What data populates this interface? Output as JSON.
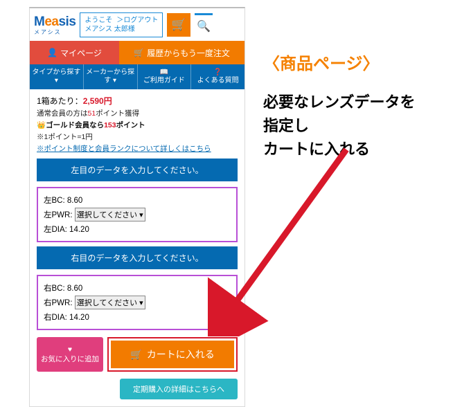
{
  "header": {
    "logo_sub": "メアシス",
    "welcome_l1": "ようこそ",
    "welcome_l2": "メアシス 太郎様",
    "logout": "＞ログアウト"
  },
  "buttons": {
    "mypage": "マイページ",
    "reorder": "履歴からもう一度注文"
  },
  "nav": {
    "type": "タイプから探す ▾",
    "maker": "メーカーから探す ▾",
    "guide": "ご利用ガイド",
    "faq": "よくある質問"
  },
  "product": {
    "price_label": "1箱あたり：",
    "price": "2,590円",
    "points_pre": "通常会員の方は",
    "points_num": "51",
    "points_post": "ポイント獲得",
    "gold_pre": "ゴールド会員なら",
    "gold_num": "153",
    "gold_post": "ポイント",
    "point_note": "※1ポイント=1円",
    "point_link": "※ポイント制度と会員ランクについて詳しくはこちら"
  },
  "left": {
    "header": "左目のデータを入力してください。",
    "bc": "左BC: 8.60",
    "pwr_label": "左PWR:",
    "pwr_select": "選択してください ▾",
    "dia": "左DIA: 14.20"
  },
  "right": {
    "header": "右目のデータを入力してください。",
    "bc": "右BC: 8.60",
    "pwr_label": "右PWR:",
    "pwr_select": "選択してください ▾",
    "dia": "右DIA: 14.20"
  },
  "actions": {
    "fav": "お気に入りに追加",
    "cart": "カートに入れる",
    "teiki": "定期購入の詳細はこちらへ"
  },
  "annot": {
    "title": "〈商品ページ〉",
    "l1": "必要なレンズデータを",
    "l2": "指定し",
    "l3": "カートに入れる"
  }
}
